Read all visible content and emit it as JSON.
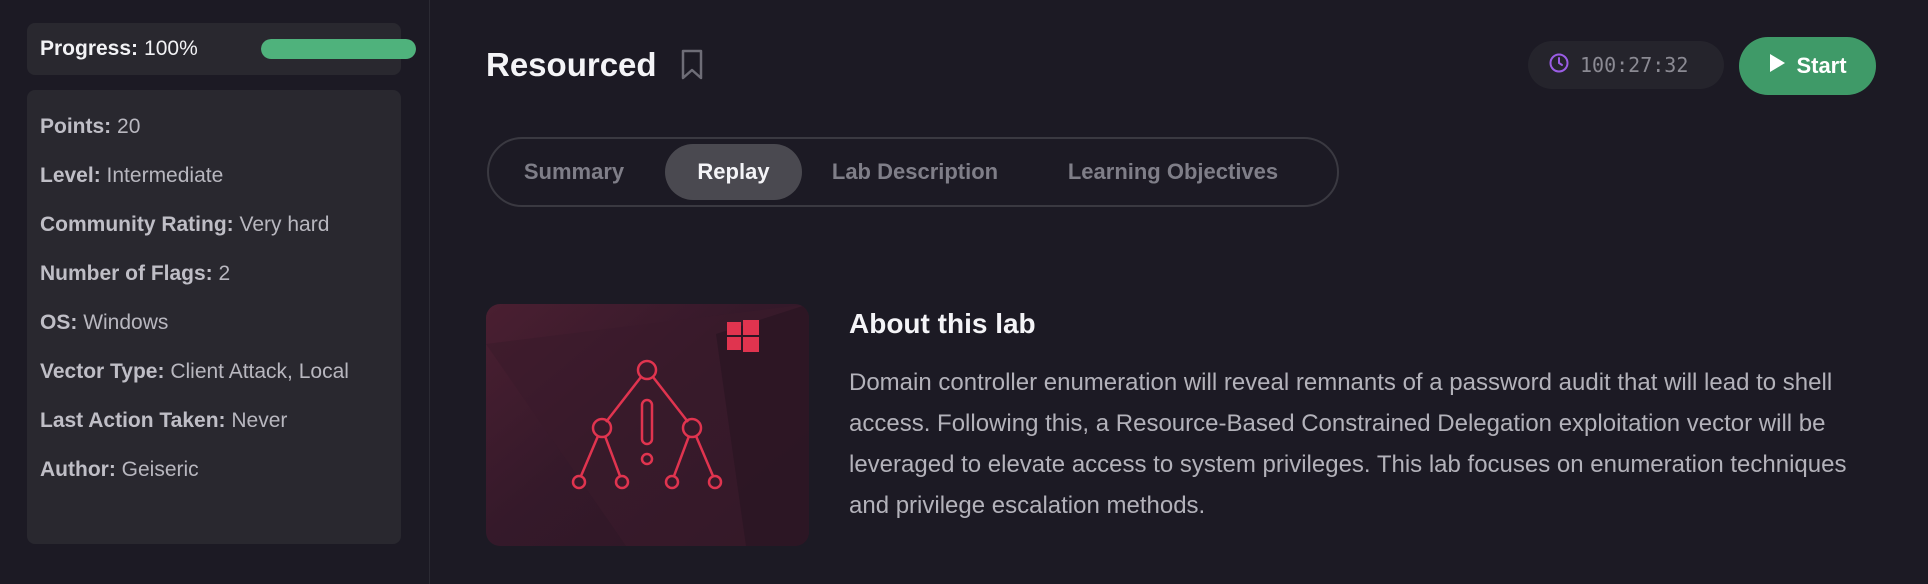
{
  "sidebar": {
    "progress": {
      "label": "Progress:",
      "value": "100%",
      "fraction": 1.0,
      "color": "#4fb27c"
    },
    "info": [
      {
        "key": "Points:",
        "value": "20"
      },
      {
        "key": "Level:",
        "value": "Intermediate"
      },
      {
        "key": "Community Rating:",
        "value": "Very hard"
      },
      {
        "key": "Number of Flags:",
        "value": "2"
      },
      {
        "key": "OS:",
        "value": "Windows"
      },
      {
        "key": "Vector Type:",
        "value": "Client Attack, Local"
      },
      {
        "key": "Last Action Taken:",
        "value": "Never"
      },
      {
        "key": "Author:",
        "value": "Geiseric"
      }
    ]
  },
  "header": {
    "title": "Resourced",
    "bookmark_icon": "bookmark-icon",
    "timer": {
      "icon": "clock-icon",
      "value": "100:27:32"
    },
    "start_button": {
      "icon": "play-icon",
      "label": "Start",
      "color": "#3f9a68"
    }
  },
  "tabs": [
    {
      "label": "Summary",
      "active": false
    },
    {
      "label": "Replay",
      "active": true
    },
    {
      "label": "Lab Description",
      "active": false
    },
    {
      "label": "Learning Objectives",
      "active": false
    }
  ],
  "about": {
    "image_icons": [
      "windows-logo-icon",
      "network-alert-icon"
    ],
    "title": "About this lab",
    "text": "Domain controller enumeration will reveal remnants of a password audit that will lead to shell access. Following this, a Resource-Based Constrained Delegation exploitation vector will be leveraged to elevate access to system privileges. This lab focuses on enumeration techniques and privilege escalation methods."
  },
  "colors": {
    "background": "#1c1a24",
    "card": "#29282f",
    "accent_red": "#e0344f"
  }
}
